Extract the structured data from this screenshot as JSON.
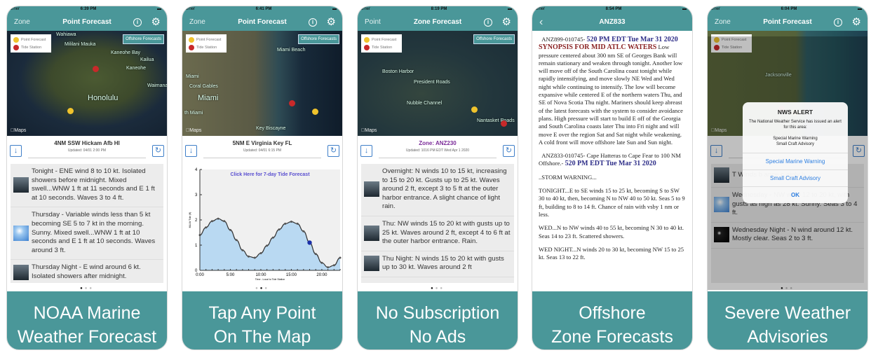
{
  "colors": {
    "teal": "#4a9799",
    "point_forecast": "#f0c32c",
    "tide_station": "#c8292a",
    "link_blue": "#2b7de0"
  },
  "common": {
    "legend_point": "Point Forecast",
    "legend_tide": "Tide Station",
    "offshore_button": "Offshore Forecasts",
    "maps_label": "Maps",
    "carrier": "arrier"
  },
  "panels": [
    {
      "time": "6:39 PM",
      "nav_left": "Zone",
      "nav_title": "Point Forecast",
      "map_theme": "oahu",
      "map_labels": [
        "Wahiawa",
        "Mililani Mauka",
        "Kaneohe Bay",
        "Kailua",
        "Kaneohe",
        "Waimanalo",
        "Honolulu"
      ],
      "location": "4NM SSW Hickam Afb HI",
      "updated": "Updated: 04/01 2:00 PM",
      "forecast": [
        {
          "icon": "showers-icon",
          "text": "Tonight - ENE wind 8 to 10 kt. Isolated showers before midnight.   Mixed swell...WNW 1 ft at 11 seconds and E 1 ft at 10 seconds. Waves 3 to 4 ft."
        },
        {
          "icon": "sunny-icon",
          "text": "Thursday - Variable winds less than 5 kt becoming SE 5 to 7 kt in the morning. Sunny. Mixed swell...WNW 1 ft at 10 seconds and E 1 ft at 10 seconds. Waves around 3 ft."
        },
        {
          "icon": "showers-icon",
          "text": "Thursday Night - E wind around 6 kt. Isolated showers after midnight."
        }
      ],
      "page": 0,
      "caption": [
        "NOAA Marine",
        "Weather Forecast"
      ]
    },
    {
      "time": "6:41 PM",
      "nav_left": "Zone",
      "nav_title": "Point Forecast",
      "map_theme": "miami",
      "map_labels": [
        "Miami Beach",
        "Miami",
        "Coral Gables",
        "Miami",
        "th Miami",
        "Key Biscayne"
      ],
      "location": "5NM E Virginia Key FL",
      "updated": "Updated: 04/01 6:15 PM",
      "tide_link": "Click Here for 7-day Tide Forecast",
      "page": 1,
      "caption": [
        "Tap Any Point",
        "On The Map"
      ]
    },
    {
      "time": "8:19 PM",
      "nav_left": "Point",
      "nav_title": "Zone Forecast",
      "map_theme": "boston",
      "map_labels": [
        "Boston Harbor",
        "President Roads",
        "Nubble Channel",
        "Nantasket Roads"
      ],
      "location": "Zone: ANZ230",
      "updated": "Updated: 1016 PM EDT Wed Apr 1 2020",
      "forecast": [
        {
          "icon": "rain-icon",
          "text": "Overnight:  N winds 10 to 15 kt, increasing to 15 to 20 kt. Gusts up to 25 kt. Waves around 2 ft, except 3 to 5 ft at the outer harbor entrance. A slight chance of light rain."
        },
        {
          "icon": "rain-icon",
          "text": "Thu:  NW winds 15 to 20 kt with gusts up to 25 kt. Waves around 2 ft, except 4 to 6 ft at the outer harbor entrance. Rain."
        },
        {
          "icon": "rain-icon",
          "text": "Thu Night:  N winds 15 to 20 kt with gusts up to 30 kt. Waves around 2 ft"
        }
      ],
      "page": 0,
      "caption": [
        "No Subscription",
        "No Ads"
      ]
    },
    {
      "time": "8:54 PM",
      "nav_title": "ANZ833",
      "doc": {
        "p1_id": "ANZ899-010745-",
        "p1_date": "520 PM EDT Tue Mar 31 2020",
        "p1_head": "SYNOPSIS FOR MID ATLC WATERS",
        "p1_text": "Low pressure centered about  300 nm SE of Georges Bank will remain stationary and weaken  through tonight. Another low will move off of the South Carolina  coast tonight while rapidly intensifying, and move slowly NE Wed  and Wed night while continuing to intensify. The low will become  expansive while centered E of the northern waters Thu, and SE of  Nova Scotia Thu night. Mariners should keep abreast of the  latest forecasts with the system to consider avoidance plans.  High pressure will start to build E off of the Georgia and South  Carolina coasts later Thu into Fri night and will move E over  the region Sat and Sat night while weakening. A cold front will  move offshore late Sun and Sun night.",
        "p2_text": "ANZ833-010745-  Cape Hatteras to Cape Fear to 100 NM Offshore.-",
        "p2_date": "520 PM EDT Tue Mar 31 2020",
        "p3": "..STORM WARNING...",
        "p4": "TONIGHT...E to SE winds 15 to 25 kt, becoming S to SW 30 to  40 kt, then, becoming N to NW 40 to 50 kt. Seas 5 to 9 ft,  building to 8 to 14 ft. Chance of rain with vsby 1 nm or less.",
        "p5": "WED...N to NW winds 40 to 55 kt, becoming N 30 to 40 kt. Seas  14 to 23 ft. Scattered showers.",
        "p6": "WED NIGHT...N winds 20 to 30 kt, becoming NW 15 to 25 kt. Seas  13 to 22 ft."
      },
      "caption": [
        "Offshore",
        "Zone Forecasts"
      ]
    },
    {
      "time": "6:04 PM",
      "nav_left": "Zone",
      "nav_title": "Point Forecast",
      "map_theme": "jax",
      "map_labels": [
        "Jacksonville"
      ],
      "location": "",
      "updated": "",
      "forecast": [
        {
          "icon": "showers-icon",
          "text": "T                                   Winds b                                   ance c                                  ainly b"
        },
        {
          "icon": "sunny-icon",
          "text": "Wednesday - NW wind 12 to 20 kt, with gusts as high as 28 kt. Sunny. Seas 3 to 4 ft."
        },
        {
          "icon": "night-clear-icon",
          "text": "Wednesday Night - N wind around 12 kt. Mostly clear. Seas 2 to 3 ft."
        }
      ],
      "alert": {
        "title": "NWS ALERT",
        "message": "The National Weather Service has issued an alert for this area:",
        "alerts_list": "Special Marine Warning\nSmall Craft Advisory",
        "buttons": [
          "Special Marine Warning",
          "Small Craft Advisory",
          "OK"
        ]
      },
      "page": 0,
      "caption": [
        "Severe Weather",
        "Advisories"
      ]
    }
  ],
  "chart_data": {
    "type": "area",
    "xlabel": "Time - Local to Tide Station",
    "ylabel": "MLLW Tide (ft)",
    "x_ticks": [
      "0:00",
      "5:00",
      "10:00",
      "15:00",
      "20:00"
    ],
    "y_ticks": [
      "0",
      "1",
      "2",
      "3",
      "4"
    ],
    "xlim": [
      0,
      23
    ],
    "ylim": [
      0,
      4
    ],
    "x": [
      0,
      1,
      2,
      3,
      4,
      5,
      6,
      7,
      8,
      9,
      10,
      11,
      12,
      13,
      14,
      15,
      16,
      17,
      18,
      19,
      20,
      21,
      22,
      23
    ],
    "values": [
      1.4,
      1.7,
      1.95,
      2.05,
      1.95,
      1.6,
      1.2,
      0.8,
      0.55,
      0.5,
      0.68,
      0.98,
      1.3,
      1.62,
      1.85,
      1.93,
      1.85,
      1.55,
      1.1,
      0.65,
      0.3,
      0.12,
      0.2,
      0.5
    ],
    "current": {
      "x": 18,
      "y": 1.1
    },
    "fill_color": "#b9d9f2",
    "line_color": "#333333",
    "current_color": "#1a2fa8"
  }
}
